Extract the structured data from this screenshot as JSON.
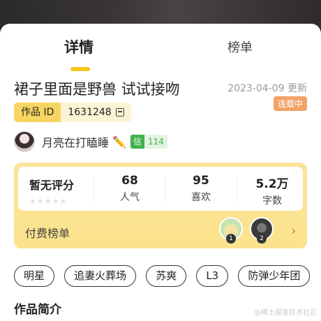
{
  "tabs": [
    {
      "label": "详情",
      "active": true
    },
    {
      "label": "榜单",
      "active": false
    }
  ],
  "work": {
    "title": "裙子里面是野兽 试试接吻",
    "update_text": "2023-04-09 更新",
    "status_badge": "连载中",
    "id_label": "作品 ID",
    "id_value": "1631248",
    "copy_icon": "copy-icon"
  },
  "author": {
    "name": "月亮在打瞌睡",
    "avatar_icon": "avatar",
    "pencil_icon": "✏️",
    "trust_label": "信",
    "trust_value": "114"
  },
  "stats": {
    "rating_label": "暂无评分",
    "rating_stars": "★★★★★",
    "items": [
      {
        "value": "68",
        "label": "人气"
      },
      {
        "value": "95",
        "label": "喜欢"
      },
      {
        "value": "5.2万",
        "label": "字数"
      }
    ]
  },
  "paid_rank": {
    "label": "付费榜单",
    "ranks": [
      "1",
      "2"
    ],
    "chevron": "›"
  },
  "tags": [
    "明星",
    "追妻火葬场",
    "苏爽",
    "L3",
    "防弹少年团"
  ],
  "section": {
    "title": "作品简介"
  },
  "watermark": "@稀土掘金技术社区",
  "colors": {
    "accent_yellow": "#f6c61c",
    "card_yellow": "#fbe49a",
    "status_orange": "#f2a268",
    "trust_green": "#3fb14b"
  }
}
